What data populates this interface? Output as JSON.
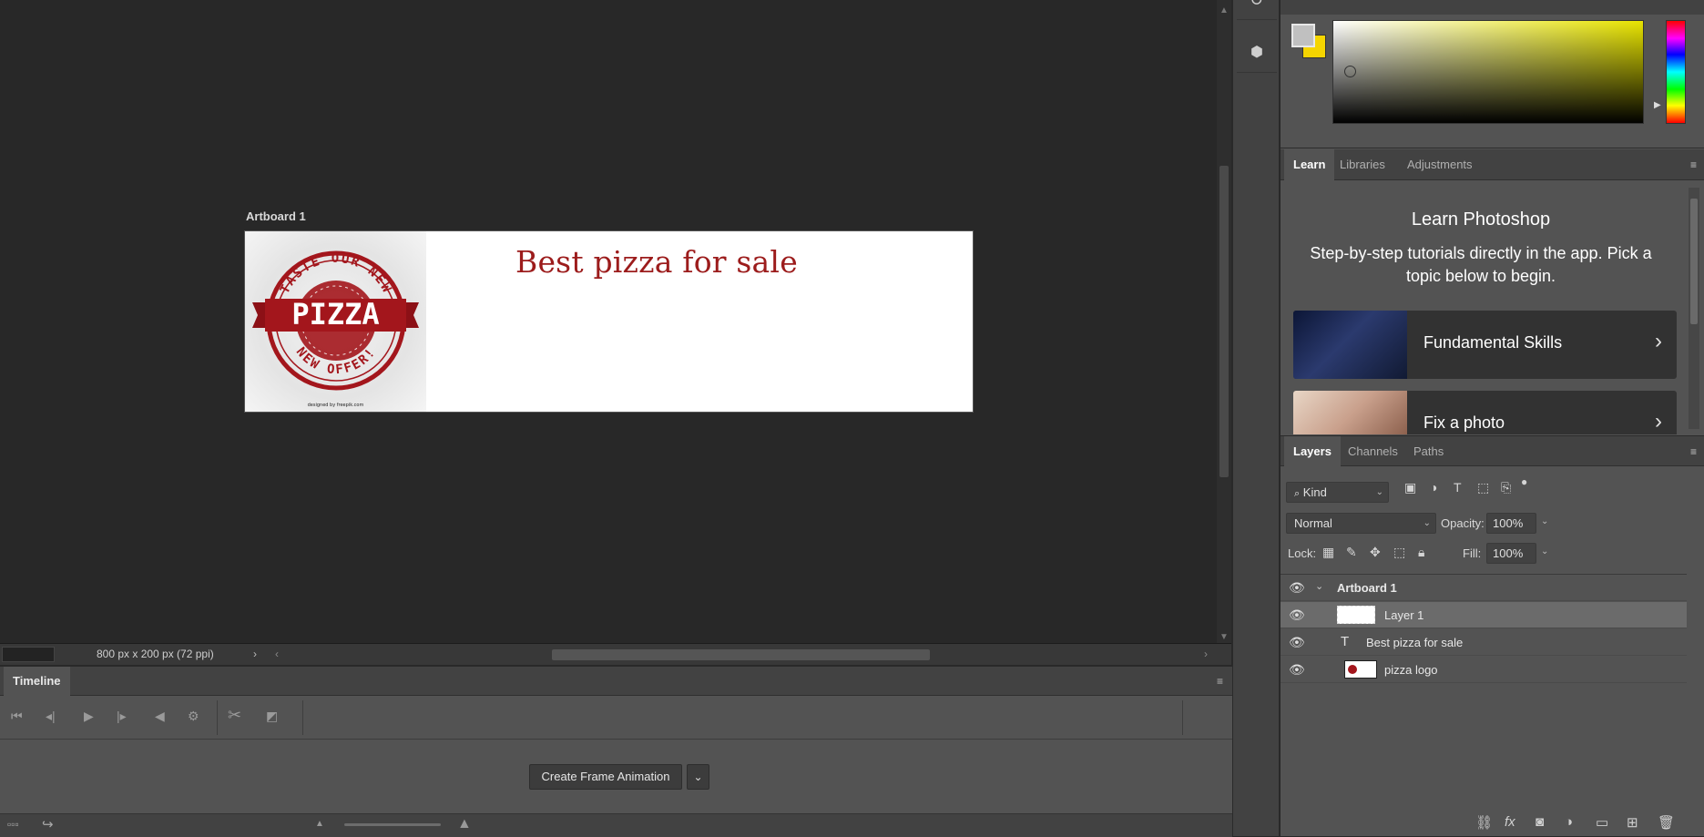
{
  "canvas": {
    "artboard_label": "Artboard 1",
    "headline": "Best pizza for sale",
    "doc_info": "800 px x 200 px (72 ppi)",
    "logo_text": {
      "arc_top": "TASTE OUR NEW",
      "banner": "PIZZA",
      "arc_bottom": "NEW OFFER!",
      "credit": "designed by freepik.com"
    }
  },
  "timeline": {
    "tab_label": "Timeline",
    "create_button": "Create Frame Animation"
  },
  "learn_panel": {
    "tabs": [
      "Learn",
      "Libraries",
      "Adjustments"
    ],
    "title": "Learn Photoshop",
    "description": "Step-by-step tutorials directly in the app. Pick a topic below to begin.",
    "cards": [
      {
        "label": "Fundamental Skills"
      },
      {
        "label": "Fix a photo"
      }
    ]
  },
  "layers_panel": {
    "tabs": [
      "Layers",
      "Channels",
      "Paths"
    ],
    "filter_kind": "Kind",
    "blend_mode": "Normal",
    "opacity_label": "Opacity:",
    "opacity_value": "100%",
    "lock_label": "Lock:",
    "fill_label": "Fill:",
    "fill_value": "100%",
    "layers": [
      {
        "name": "Artboard 1",
        "type": "artboard"
      },
      {
        "name": "Layer 1",
        "type": "pixel",
        "selected": true
      },
      {
        "name": "Best pizza for sale",
        "type": "text"
      },
      {
        "name": "pizza logo",
        "type": "pixel"
      }
    ]
  },
  "colors": {
    "foreground": "#c0c0c0",
    "background": "#f5d500",
    "headline_red": "#9c1c1c"
  }
}
